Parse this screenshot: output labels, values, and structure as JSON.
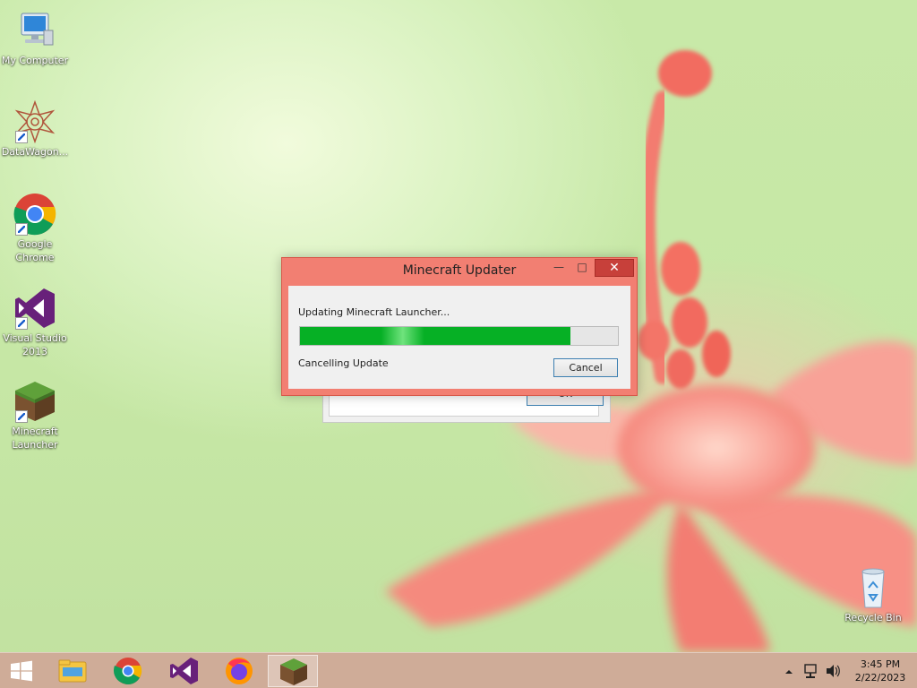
{
  "desktop": {
    "icons": [
      {
        "label": "My Computer",
        "icon": "computer-icon"
      },
      {
        "label": "DataWagon...",
        "icon": "datawagon-icon"
      },
      {
        "label": "Google Chrome",
        "icon": "chrome-icon"
      },
      {
        "label": "Visual Studio 2013",
        "icon": "visual-studio-icon"
      },
      {
        "label": "Minecraft Launcher",
        "icon": "minecraft-icon"
      },
      {
        "label": "Recycle Bin",
        "icon": "recycle-bin-icon"
      }
    ]
  },
  "background_dialog": {
    "ok_label": "OK"
  },
  "updater": {
    "title": "Minecraft Updater",
    "minimize_glyph": "—",
    "maximize_glyph": "□",
    "close_glyph": "✕",
    "status_top": "Updating Minecraft Launcher...",
    "progress_fraction": 0.85,
    "status_bottom": "Cancelling Update",
    "cancel_label": "Cancel",
    "window_color": "#f27f72",
    "progress_color": "#06b025"
  },
  "taskbar": {
    "items": [
      {
        "name": "File Explorer",
        "icon": "file-explorer-icon"
      },
      {
        "name": "Google Chrome",
        "icon": "chrome-icon"
      },
      {
        "name": "Visual Studio",
        "icon": "visual-studio-icon"
      },
      {
        "name": "Firefox",
        "icon": "firefox-icon"
      },
      {
        "name": "Minecraft Launcher",
        "icon": "minecraft-icon",
        "active": true
      }
    ],
    "clock_time": "3:45 PM",
    "clock_date": "2/22/2023"
  }
}
